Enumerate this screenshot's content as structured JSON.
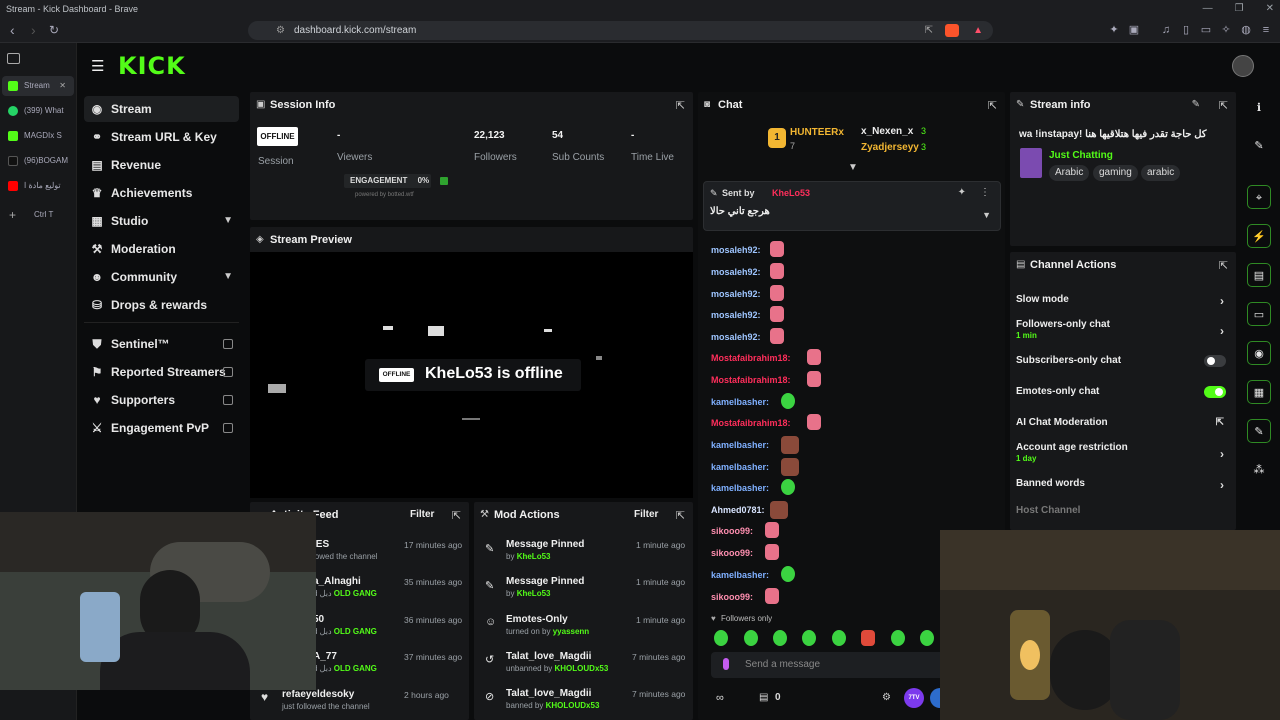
{
  "browser": {
    "window_title": "Stream - Kick Dashboard - Brave",
    "url": "dashboard.kick.com/stream",
    "tabs": [
      {
        "label": "Stream",
        "color": "#53fc18"
      },
      {
        "label": "(399) What",
        "color": "#25d366"
      },
      {
        "label": "MAGDIx S",
        "color": "#53fc18"
      },
      {
        "label": "(96)BOGAM",
        "color": "#222"
      },
      {
        "label": "توليع مادة ا",
        "color": "#ff0000"
      }
    ],
    "new_tab_hint": "Ctrl T"
  },
  "brand": {
    "logo_text": "KICK",
    "accent": "#53fc18"
  },
  "sidebar": {
    "items": [
      {
        "label": "Stream",
        "icon": "camera-icon"
      },
      {
        "label": "Stream URL & Key",
        "icon": "link-icon"
      },
      {
        "label": "Revenue",
        "icon": "revenue-icon"
      },
      {
        "label": "Achievements",
        "icon": "trophy-icon"
      },
      {
        "label": "Studio",
        "icon": "studio-icon"
      },
      {
        "label": "Moderation",
        "icon": "hammer-icon"
      },
      {
        "label": "Community",
        "icon": "community-icon"
      },
      {
        "label": "Drops & rewards",
        "icon": "drops-icon"
      },
      {
        "label": "Sentinel™",
        "icon": "shield-icon"
      },
      {
        "label": "Reported Streamers",
        "icon": "flag-icon"
      },
      {
        "label": "Supporters",
        "icon": "heart-icon"
      },
      {
        "label": "Engagement PvP",
        "icon": "swords-icon"
      }
    ]
  },
  "session": {
    "title": "Session Info",
    "status_badge": "OFFLINE",
    "session_label": "Session",
    "viewers_value": "-",
    "viewers_label": "Viewers",
    "followers_value": "22,123",
    "followers_label": "Followers",
    "subs_value": "54",
    "subs_label": "Sub Counts",
    "time_value": "-",
    "time_label": "Time Live",
    "engagement_label": "ENGAGEMENT",
    "engagement_value": "0%",
    "powered_by": "powered by botted.wtf"
  },
  "preview": {
    "title": "Stream Preview",
    "badge": "OFFLINE",
    "message": "KheLo53 is offline"
  },
  "activity": {
    "title": "Activity Feed",
    "filter": "Filter",
    "rows": [
      {
        "name": "IES",
        "sub": "lowed the channel",
        "tag": "",
        "time": "17 minutes ago"
      },
      {
        "name": "a_Alnaghi",
        "sub": "d دبل",
        "tag": "OLD GANG",
        "time": "35 minutes ago"
      },
      {
        "name": "50",
        "sub": "d دبل",
        "tag": "OLD GANG",
        "time": "36 minutes ago"
      },
      {
        "name": "A_77",
        "sub": "d دبل",
        "tag": "OLD GANG",
        "time": "37 minutes ago"
      },
      {
        "name": "refaeyeldesoky",
        "sub": "just followed the channel",
        "tag": "",
        "time": "2 hours ago"
      }
    ]
  },
  "mod_actions": {
    "title": "Mod Actions",
    "filter": "Filter",
    "rows": [
      {
        "name": "Message Pinned",
        "sub": "by",
        "who": "KheLo53",
        "time": "1 minute ago",
        "icon": "pin-icon"
      },
      {
        "name": "Message Pinned",
        "sub": "by",
        "who": "KheLo53",
        "time": "1 minute ago",
        "icon": "pin-icon"
      },
      {
        "name": "Emotes-Only",
        "sub": "turned on by",
        "who": "yyassenn",
        "time": "1 minute ago",
        "icon": "smile-icon"
      },
      {
        "name": "Talat_love_Magdii",
        "sub": "unbanned by",
        "who": "KHOLOUDx53",
        "time": "7 minutes ago",
        "icon": "undo-icon"
      },
      {
        "name": "Talat_love_Magdii",
        "sub": "banned by",
        "who": "KHOLOUDx53",
        "time": "7 minutes ago",
        "icon": "ban-icon"
      }
    ]
  },
  "chat": {
    "title": "Chat",
    "top_gifters": [
      {
        "name": "HUNTEERx",
        "count": "7"
      },
      {
        "name": "x_Nexen_x",
        "count": "3"
      },
      {
        "name": "Zyadjerseyy",
        "count": "3"
      }
    ],
    "pinned": {
      "label": "Sent by",
      "user": "KheLo53",
      "text": "هرجع تاني حالا"
    },
    "messages": [
      {
        "user": "mosaleh92:",
        "color": "#9ec5ff",
        "emote": "pink"
      },
      {
        "user": "mosaleh92:",
        "color": "#9ec5ff",
        "emote": "pink"
      },
      {
        "user": "mosaleh92:",
        "color": "#9ec5ff",
        "emote": "pink"
      },
      {
        "user": "mosaleh92:",
        "color": "#9ec5ff",
        "emote": "pink"
      },
      {
        "user": "mosaleh92:",
        "color": "#9ec5ff",
        "emote": "pink"
      },
      {
        "user": "Mostafaibrahim18:",
        "color": "#ff2e5b",
        "emote": "pink"
      },
      {
        "user": "Mostafaibrahim18:",
        "color": "#ff2e5b",
        "emote": "pink"
      },
      {
        "user": "kamelbasher:",
        "color": "#7fb0ff",
        "emote": "green"
      },
      {
        "user": "Mostafaibrahim18:",
        "color": "#ff2e5b",
        "emote": "pink"
      },
      {
        "user": "kamelbasher:",
        "color": "#7fb0ff",
        "emote": "face"
      },
      {
        "user": "kamelbasher:",
        "color": "#7fb0ff",
        "emote": "face"
      },
      {
        "user": "kamelbasher:",
        "color": "#7fb0ff",
        "emote": "green"
      },
      {
        "user": "Ahmed0781:",
        "color": "#d8e4ff",
        "emote": "face"
      },
      {
        "user": "sikooo99:",
        "color": "#ff8fb0",
        "emote": "pink"
      },
      {
        "user": "sikooo99:",
        "color": "#ff8fb0",
        "emote": "pink"
      },
      {
        "user": "kamelbasher:",
        "color": "#7fb0ff",
        "emote": "green"
      },
      {
        "user": "sikooo99:",
        "color": "#ff8fb0",
        "emote": "pink"
      }
    ],
    "followers_only": "Followers only",
    "input_placeholder": "Send a message",
    "viewer_count": "0"
  },
  "stream_info": {
    "title": "Stream info",
    "stream_title": "wa !instapay! كل حاجة تقدر فيها هتلاقيها هنا",
    "category": "Just Chatting",
    "tags": [
      "Arabic",
      "gaming",
      "arabic"
    ]
  },
  "channel_actions": {
    "title": "Channel Actions",
    "rows": [
      {
        "label": "Slow mode",
        "sub": "",
        "control": "arrow"
      },
      {
        "label": "Followers-only chat",
        "sub": "1 min",
        "control": "arrow"
      },
      {
        "label": "Subscribers-only chat",
        "sub": "",
        "control": "toggle-off"
      },
      {
        "label": "Emotes-only chat",
        "sub": "",
        "control": "toggle-on"
      },
      {
        "label": "AI Chat Moderation",
        "sub": "",
        "control": "external"
      },
      {
        "label": "Account age restriction",
        "sub": "1 day",
        "control": "arrow"
      },
      {
        "label": "Banned words",
        "sub": "",
        "control": "arrow"
      },
      {
        "label": "Host Channel",
        "sub": "",
        "control": "none"
      }
    ]
  },
  "colors": {
    "accent": "#53fc18",
    "panel": "#17181a",
    "bg": "#0b0c0d",
    "red_user": "#ff2e5b"
  }
}
